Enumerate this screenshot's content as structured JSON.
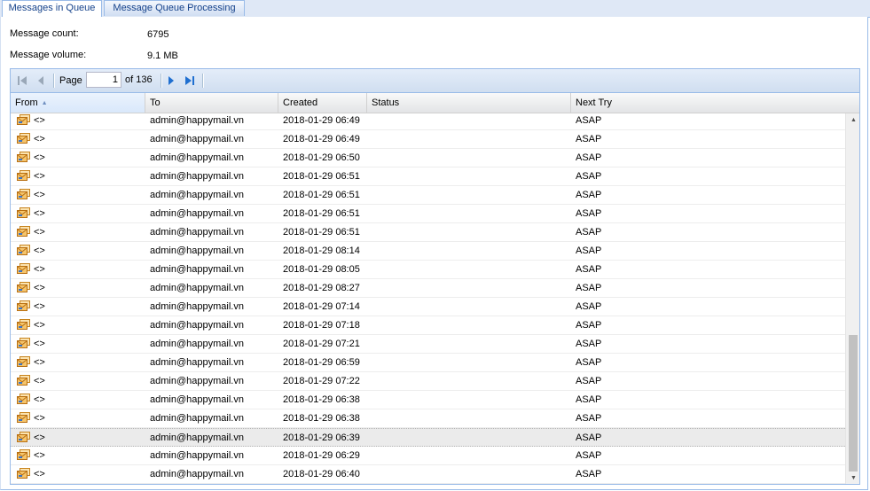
{
  "tabs": [
    {
      "label": "Messages in Queue",
      "active": true
    },
    {
      "label": "Message Queue Processing",
      "active": false
    }
  ],
  "info": {
    "count_label": "Message count:",
    "count_value": "6795",
    "volume_label": "Message volume:",
    "volume_value": "9.1 MB"
  },
  "pager": {
    "page_label": "Page",
    "page_value": "1",
    "of_label": "of 136"
  },
  "columns": {
    "from": "From",
    "to": "To",
    "created": "Created",
    "status": "Status",
    "next_try": "Next Try"
  },
  "rows": [
    {
      "from": "<>",
      "to": "admin@happymail.vn",
      "created": "2018-01-29 06:49",
      "status": "",
      "next_try": "ASAP"
    },
    {
      "from": "<>",
      "to": "admin@happymail.vn",
      "created": "2018-01-29 06:49",
      "status": "",
      "next_try": "ASAP"
    },
    {
      "from": "<>",
      "to": "admin@happymail.vn",
      "created": "2018-01-29 06:50",
      "status": "",
      "next_try": "ASAP"
    },
    {
      "from": "<>",
      "to": "admin@happymail.vn",
      "created": "2018-01-29 06:51",
      "status": "",
      "next_try": "ASAP"
    },
    {
      "from": "<>",
      "to": "admin@happymail.vn",
      "created": "2018-01-29 06:51",
      "status": "",
      "next_try": "ASAP"
    },
    {
      "from": "<>",
      "to": "admin@happymail.vn",
      "created": "2018-01-29 06:51",
      "status": "",
      "next_try": "ASAP"
    },
    {
      "from": "<>",
      "to": "admin@happymail.vn",
      "created": "2018-01-29 06:51",
      "status": "",
      "next_try": "ASAP"
    },
    {
      "from": "<>",
      "to": "admin@happymail.vn",
      "created": "2018-01-29 08:14",
      "status": "",
      "next_try": "ASAP"
    },
    {
      "from": "<>",
      "to": "admin@happymail.vn",
      "created": "2018-01-29 08:05",
      "status": "",
      "next_try": "ASAP"
    },
    {
      "from": "<>",
      "to": "admin@happymail.vn",
      "created": "2018-01-29 08:27",
      "status": "",
      "next_try": "ASAP"
    },
    {
      "from": "<>",
      "to": "admin@happymail.vn",
      "created": "2018-01-29 07:14",
      "status": "",
      "next_try": "ASAP"
    },
    {
      "from": "<>",
      "to": "admin@happymail.vn",
      "created": "2018-01-29 07:18",
      "status": "",
      "next_try": "ASAP"
    },
    {
      "from": "<>",
      "to": "admin@happymail.vn",
      "created": "2018-01-29 07:21",
      "status": "",
      "next_try": "ASAP"
    },
    {
      "from": "<>",
      "to": "admin@happymail.vn",
      "created": "2018-01-29 06:59",
      "status": "",
      "next_try": "ASAP"
    },
    {
      "from": "<>",
      "to": "admin@happymail.vn",
      "created": "2018-01-29 07:22",
      "status": "",
      "next_try": "ASAP"
    },
    {
      "from": "<>",
      "to": "admin@happymail.vn",
      "created": "2018-01-29 06:38",
      "status": "",
      "next_try": "ASAP"
    },
    {
      "from": "<>",
      "to": "admin@happymail.vn",
      "created": "2018-01-29 06:38",
      "status": "",
      "next_try": "ASAP"
    },
    {
      "from": "<>",
      "to": "admin@happymail.vn",
      "created": "2018-01-29 06:39",
      "status": "",
      "next_try": "ASAP",
      "selected": true
    },
    {
      "from": "<>",
      "to": "admin@happymail.vn",
      "created": "2018-01-29 06:29",
      "status": "",
      "next_try": "ASAP"
    },
    {
      "from": "<>",
      "to": "admin@happymail.vn",
      "created": "2018-01-29 06:40",
      "status": "",
      "next_try": "ASAP"
    }
  ],
  "icons": {
    "first": "first-page-icon",
    "prev": "prev-page-icon",
    "next": "next-page-icon",
    "last": "last-page-icon",
    "row": "envelope-stack-icon",
    "sort": "sort-ascending-icon"
  },
  "colors": {
    "tab_bg": "#dfe8f6",
    "border": "#99bbe8",
    "nav_blue": "#1f6fd0",
    "icon_orange": "#e89a2c"
  }
}
